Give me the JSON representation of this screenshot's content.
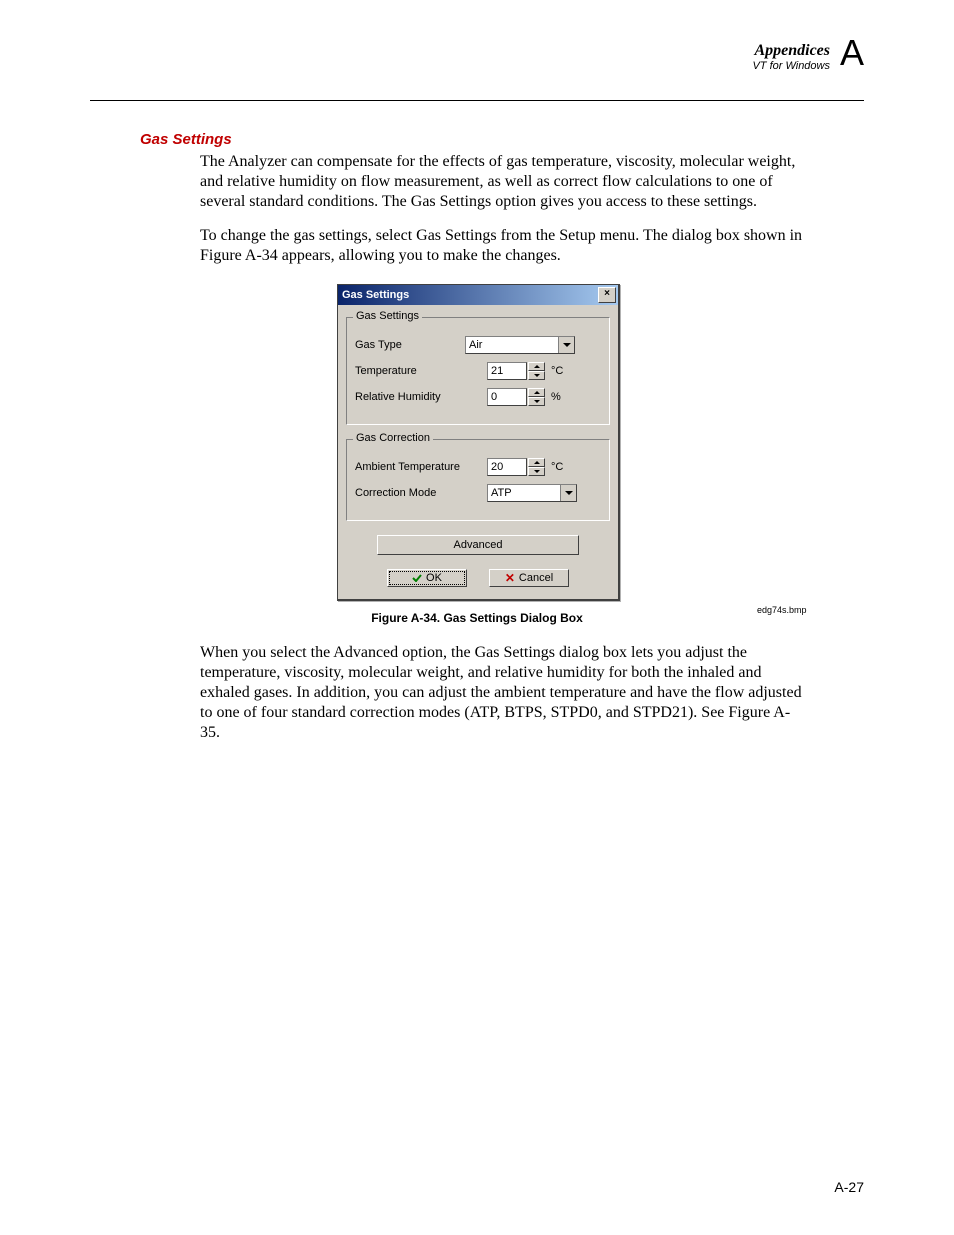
{
  "header": {
    "appendices": "Appendices",
    "subtitle": "VT for Windows",
    "letter": "A"
  },
  "section_title": "Gas Settings",
  "paragraph1": "The Analyzer can compensate for the effects of gas temperature, viscosity, molecular weight, and relative humidity on flow measurement, as well as correct flow calculations to one of several standard conditions. The Gas Settings option gives you access to these settings.",
  "paragraph2": "To change the gas settings, select Gas Settings from the Setup menu. The dialog box shown in Figure A-34 appears, allowing you to make the changes.",
  "dialog": {
    "title": "Gas Settings",
    "close_symbol": "×",
    "group1": {
      "legend": "Gas Settings",
      "gas_type_label": "Gas Type",
      "gas_type_value": "Air",
      "temperature_label": "Temperature",
      "temperature_value": "21",
      "temperature_unit": "°C",
      "rh_label": "Relative Humidity",
      "rh_value": "0",
      "rh_unit": "%"
    },
    "group2": {
      "legend": "Gas Correction",
      "ambient_label": "Ambient Temperature",
      "ambient_value": "20",
      "ambient_unit": "°C",
      "mode_label": "Correction Mode",
      "mode_value": "ATP"
    },
    "advanced_label": "Advanced",
    "ok_label": "OK",
    "cancel_label": "Cancel"
  },
  "image_ref": "edg74s.bmp",
  "figure_caption": "Figure A-34. Gas Settings Dialog Box",
  "paragraph3": "When you select the Advanced option, the Gas Settings dialog box lets you adjust the temperature, viscosity, molecular weight, and relative humidity for both the inhaled and exhaled gases. In addition, you can adjust the ambient temperature and have the flow adjusted to one of four standard correction modes (ATP, BTPS, STPD0, and STPD21). See Figure A-35.",
  "page_number": "A-27"
}
